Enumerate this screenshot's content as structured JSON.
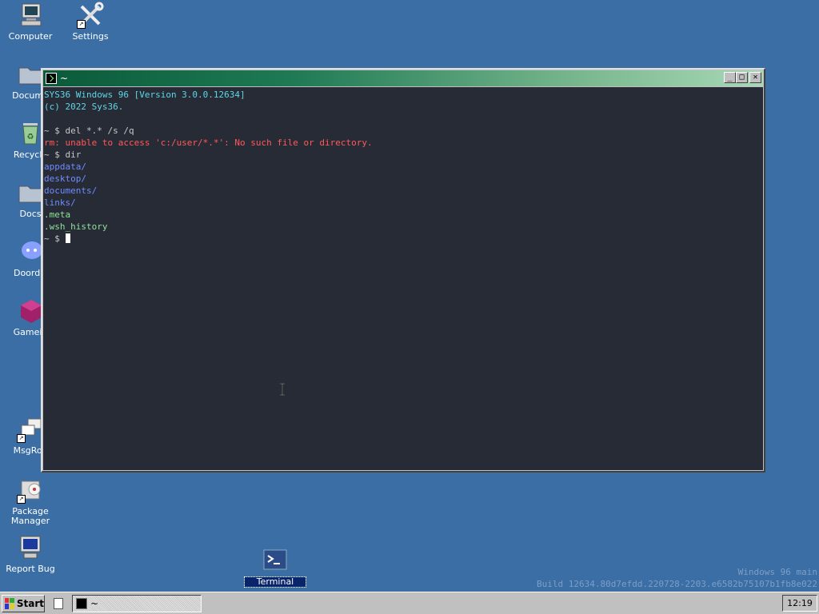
{
  "desktop": {
    "icons": [
      {
        "label": "Computer"
      },
      {
        "label": "Settings"
      },
      {
        "label": "Docume"
      },
      {
        "label": "Recycle"
      },
      {
        "label": "Docs"
      },
      {
        "label": "Doordis"
      },
      {
        "label": "Gamein"
      },
      {
        "label": "MsgRoo"
      },
      {
        "label": "Package Manager"
      },
      {
        "label": "Report Bug"
      },
      {
        "label": "Terminal"
      }
    ],
    "watermark": {
      "line1": "Windows 96 main",
      "line2": "Build 12634.80d7efdd.220728-2203.e6582b75107b1fb8e022"
    }
  },
  "window": {
    "title": "~",
    "buttons": {
      "minimize": "_",
      "maximize": "□",
      "close": "✕"
    },
    "terminal_lines": [
      {
        "text": "SYS36 Windows 96 [Version 3.0.0.12634]",
        "color": "cyan"
      },
      {
        "text": "(c) 2022 Sys36.",
        "color": "cyan"
      },
      {
        "text": "",
        "color": "gray"
      },
      {
        "text": "~ $ del *.* /s /q",
        "color": "gray"
      },
      {
        "text": "rm: unable to access 'c:/user/*.*': No such file or directory.",
        "color": "red"
      },
      {
        "text": "~ $ dir",
        "color": "gray"
      },
      {
        "text": "appdata/",
        "color": "blue"
      },
      {
        "text": "desktop/",
        "color": "blue"
      },
      {
        "text": "documents/",
        "color": "blue"
      },
      {
        "text": "links/",
        "color": "blue"
      },
      {
        "text": ".meta",
        "color": "green"
      },
      {
        "text": ".wsh_history",
        "color": "green"
      }
    ],
    "prompt": "~ $ "
  },
  "taskbar": {
    "start_label": "Start",
    "task_title": "~",
    "clock": "12:19"
  },
  "colors": {
    "desktop": "#3b6ea5",
    "terminal_bg": "#272b35",
    "titlebar": "#0a5a3a"
  }
}
